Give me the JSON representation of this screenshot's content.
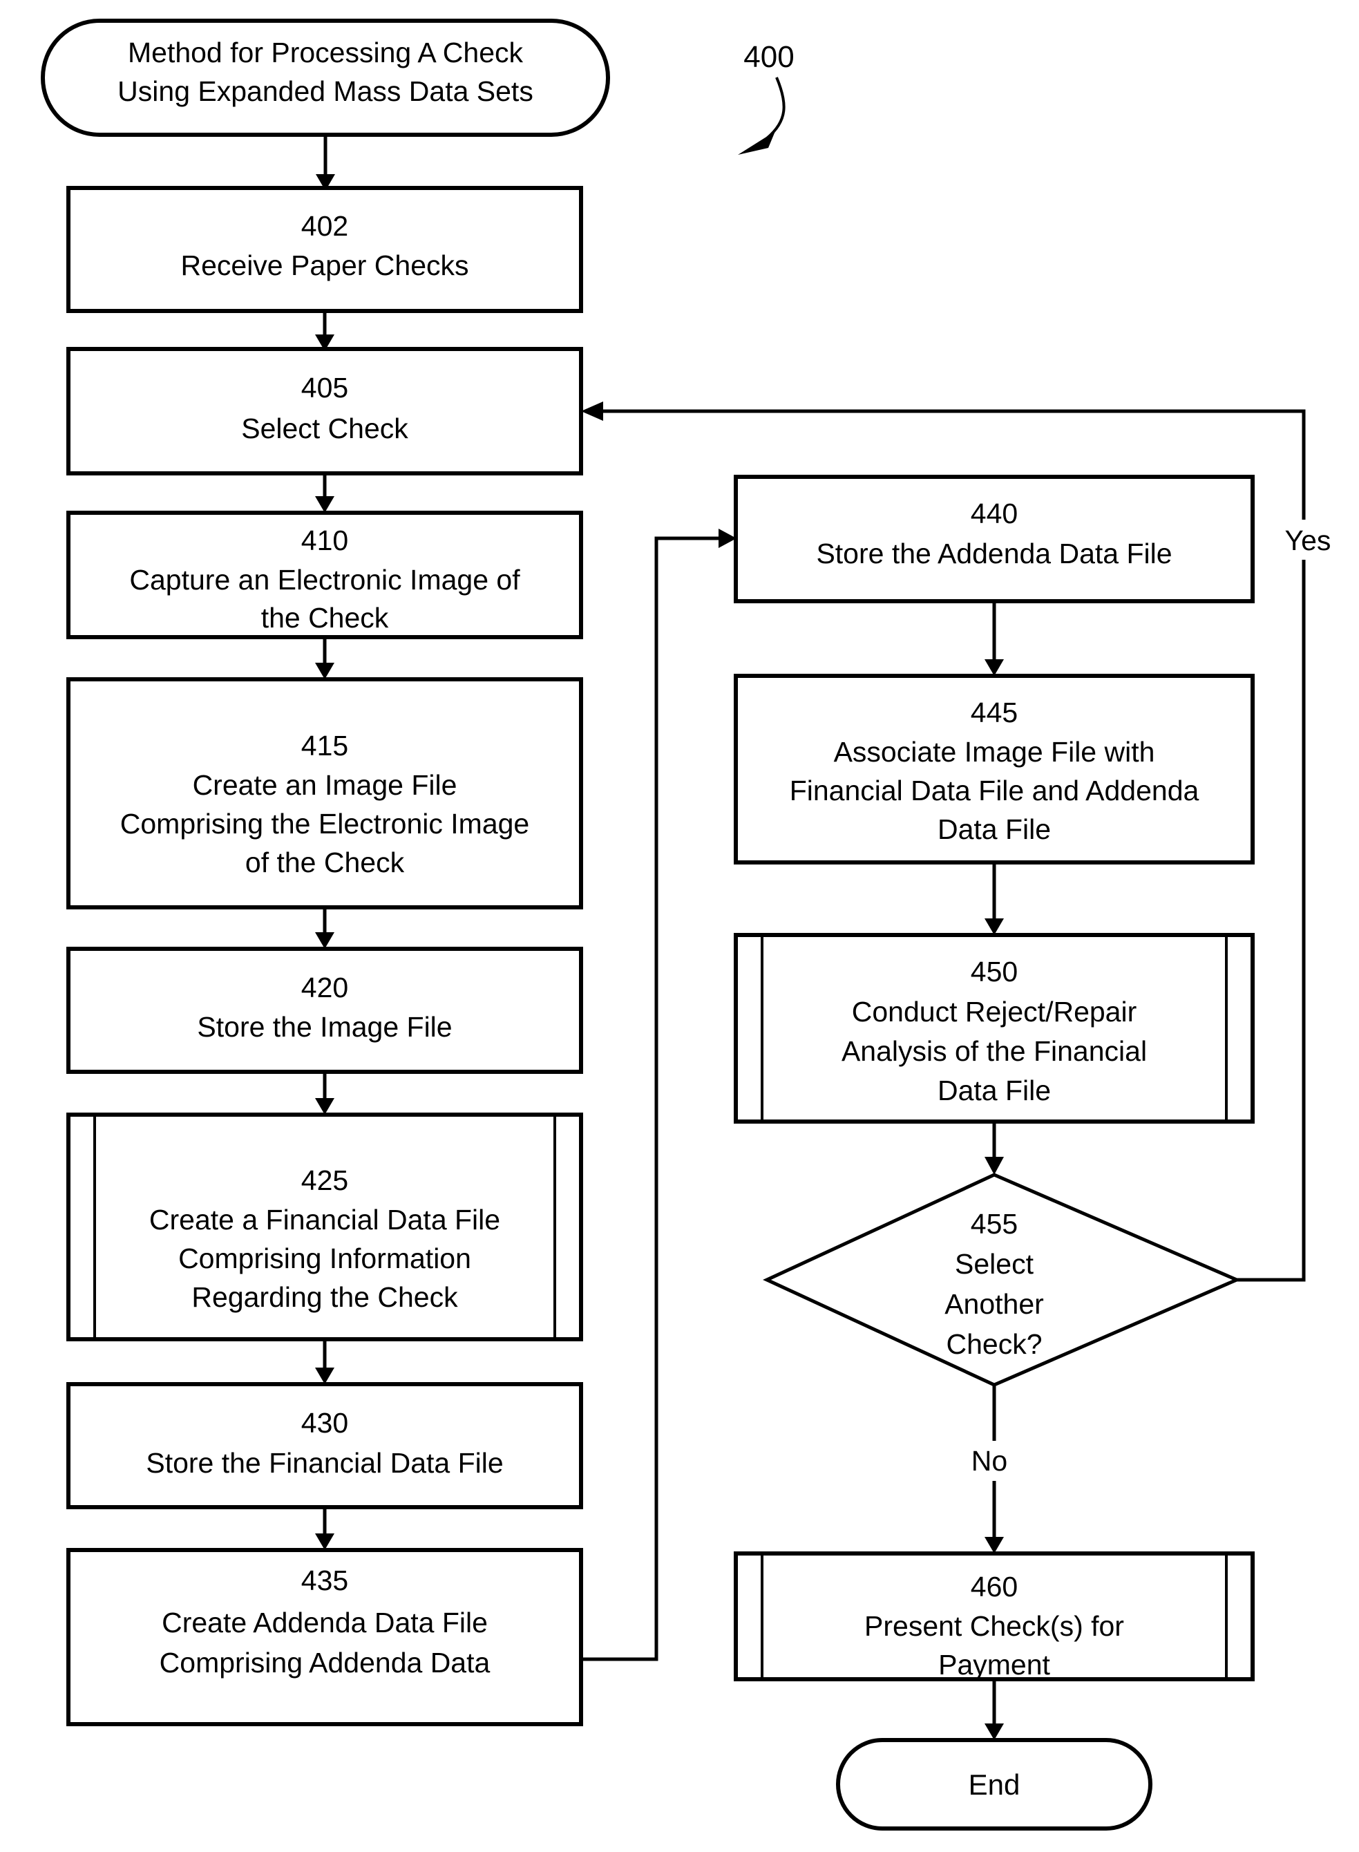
{
  "figure": {
    "reference_numeral": "400",
    "title_terminator": {
      "id": "start",
      "line1": "Method for Processing A Check",
      "line2": "Using Expanded Mass Data Sets"
    },
    "end_terminator": {
      "id": "end",
      "label": "End"
    }
  },
  "nodes": {
    "n402": {
      "number": "402",
      "line1": "Receive Paper Checks",
      "line2": "",
      "line3": ""
    },
    "n405": {
      "number": "405",
      "line1": "Select Check",
      "line2": "",
      "line3": ""
    },
    "n410": {
      "number": "410",
      "line1": "Capture an Electronic Image of",
      "line2": "the Check",
      "line3": ""
    },
    "n415": {
      "number": "415",
      "line1": "Create an Image File",
      "line2": "Comprising the Electronic Image",
      "line3": "of the Check"
    },
    "n420": {
      "number": "420",
      "line1": "Store the Image File",
      "line2": "",
      "line3": ""
    },
    "n425": {
      "number": "425",
      "line1": "Create a Financial Data File",
      "line2": "Comprising Information",
      "line3": "Regarding the Check"
    },
    "n430": {
      "number": "430",
      "line1": "Store the Financial Data File",
      "line2": "",
      "line3": ""
    },
    "n435": {
      "number": "435",
      "line1": "Create Addenda Data File",
      "line2": "Comprising Addenda Data",
      "line3": ""
    },
    "n440": {
      "number": "440",
      "line1": "Store the Addenda Data File",
      "line2": "",
      "line3": ""
    },
    "n445": {
      "number": "445",
      "line1": "Associate Image File with",
      "line2": "Financial Data File and Addenda",
      "line3": "Data File"
    },
    "n450": {
      "number": "450",
      "line1": "Conduct Reject/Repair",
      "line2": "Analysis of the Financial",
      "line3": "Data File"
    },
    "n455": {
      "number": "455",
      "line1": "Select",
      "line2": "Another",
      "line3": "Check?"
    },
    "n460": {
      "number": "460",
      "line1": "Present Check(s) for",
      "line2": "Payment",
      "line3": ""
    }
  },
  "edge_labels": {
    "yes": "Yes",
    "no": "No"
  },
  "chart_data": {
    "type": "diagram",
    "diagram_kind": "flowchart",
    "title": "Method for Processing A Check Using Expanded Mass Data Sets",
    "figure_number": "400",
    "shapes": [
      {
        "id": "start",
        "shape": "terminator",
        "text": "Method for Processing A Check Using Expanded Mass Data Sets"
      },
      {
        "id": "402",
        "shape": "process",
        "text": "Receive Paper Checks"
      },
      {
        "id": "405",
        "shape": "process",
        "text": "Select Check"
      },
      {
        "id": "410",
        "shape": "process",
        "text": "Capture an Electronic Image of the Check"
      },
      {
        "id": "415",
        "shape": "process",
        "text": "Create an Image File Comprising the Electronic Image of the Check"
      },
      {
        "id": "420",
        "shape": "process",
        "text": "Store the Image File"
      },
      {
        "id": "425",
        "shape": "predefined-process",
        "text": "Create a Financial Data File Comprising Information Regarding the Check"
      },
      {
        "id": "430",
        "shape": "process",
        "text": "Store the Financial Data File"
      },
      {
        "id": "435",
        "shape": "process",
        "text": "Create Addenda Data File Comprising Addenda Data"
      },
      {
        "id": "440",
        "shape": "process",
        "text": "Store the Addenda Data File"
      },
      {
        "id": "445",
        "shape": "process",
        "text": "Associate Image File with Financial Data File and Addenda Data File"
      },
      {
        "id": "450",
        "shape": "predefined-process",
        "text": "Conduct Reject/Repair Analysis of the Financial Data File"
      },
      {
        "id": "455",
        "shape": "decision",
        "text": "Select Another Check?"
      },
      {
        "id": "460",
        "shape": "predefined-process",
        "text": "Present Check(s) for Payment"
      },
      {
        "id": "end",
        "shape": "terminator",
        "text": "End"
      }
    ],
    "edges": [
      {
        "from": "start",
        "to": "402",
        "label": ""
      },
      {
        "from": "402",
        "to": "405",
        "label": ""
      },
      {
        "from": "405",
        "to": "410",
        "label": ""
      },
      {
        "from": "410",
        "to": "415",
        "label": ""
      },
      {
        "from": "415",
        "to": "420",
        "label": ""
      },
      {
        "from": "420",
        "to": "425",
        "label": ""
      },
      {
        "from": "425",
        "to": "430",
        "label": ""
      },
      {
        "from": "430",
        "to": "435",
        "label": ""
      },
      {
        "from": "435",
        "to": "440",
        "label": ""
      },
      {
        "from": "440",
        "to": "445",
        "label": ""
      },
      {
        "from": "445",
        "to": "450",
        "label": ""
      },
      {
        "from": "450",
        "to": "455",
        "label": ""
      },
      {
        "from": "455",
        "to": "405",
        "label": "Yes"
      },
      {
        "from": "455",
        "to": "460",
        "label": "No"
      },
      {
        "from": "460",
        "to": "end",
        "label": ""
      }
    ]
  }
}
